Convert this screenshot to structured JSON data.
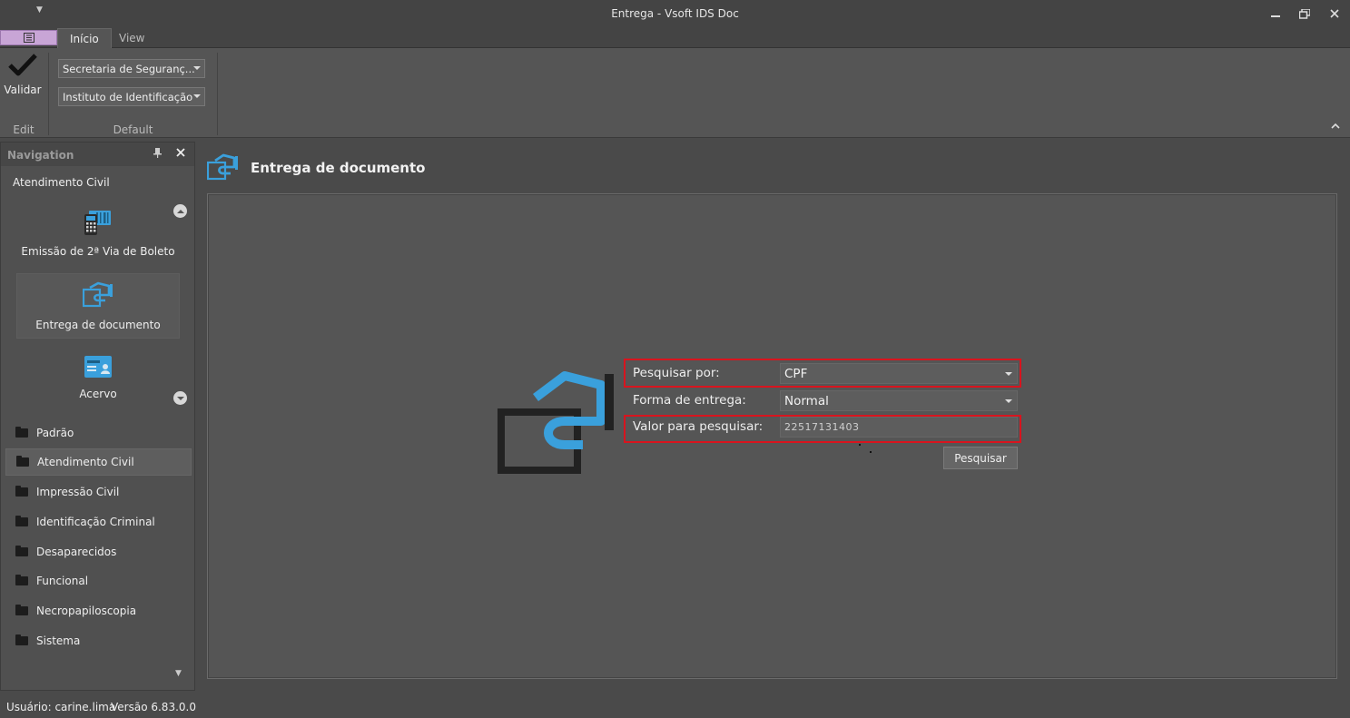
{
  "window": {
    "title": "Entrega - Vsoft IDS Doc",
    "qat_icon": "dropdown-arrow-icon",
    "controls": [
      "minimize-icon",
      "restore-icon",
      "close-icon"
    ]
  },
  "ribbon": {
    "tabs": [
      {
        "label": "Início",
        "active": true
      },
      {
        "label": "View",
        "active": false
      }
    ],
    "edit_group": {
      "label": "Edit",
      "validar_label": "Validar",
      "validar_icon": "checkmark-icon"
    },
    "default_group": {
      "label": "Default",
      "combo1_value": "Secretaria de Seguranç...",
      "combo2_value": "Instituto de Identificação"
    }
  },
  "navigation": {
    "title": "Navigation",
    "group_title": "Atendimento Civil",
    "big_items": [
      {
        "label": "Emissão de 2ª Via de Boleto",
        "icon": "payment-terminal-icon"
      },
      {
        "label": "Entrega de documento",
        "icon": "document-delivery-icon",
        "selected": true
      },
      {
        "label": "Acervo",
        "icon": "id-card-icon"
      }
    ],
    "list": [
      {
        "label": "Padrão"
      },
      {
        "label": "Atendimento Civil",
        "selected": true
      },
      {
        "label": "Impressão Civil"
      },
      {
        "label": "Identificação Criminal"
      },
      {
        "label": "Desaparecidos"
      },
      {
        "label": "Funcional"
      },
      {
        "label": "Necropapiloscopia"
      },
      {
        "label": "Sistema"
      }
    ]
  },
  "main": {
    "title": "Entrega de documento",
    "form": {
      "pesquisar_label": "Pesquisar por:",
      "pesquisar_value": "CPF",
      "forma_label": "Forma de entrega:",
      "forma_value": "Normal",
      "valor_label": "Valor para pesquisar:",
      "valor_value": "22517131403",
      "button_label": "Pesquisar"
    }
  },
  "status": {
    "user": "Usuário: carine.lima",
    "version": "Versão 6.83.0.0"
  },
  "colors": {
    "accent_blue": "#3aa0dc",
    "highlight_red": "#d8141e",
    "app_menu": "#c8a5d6"
  }
}
